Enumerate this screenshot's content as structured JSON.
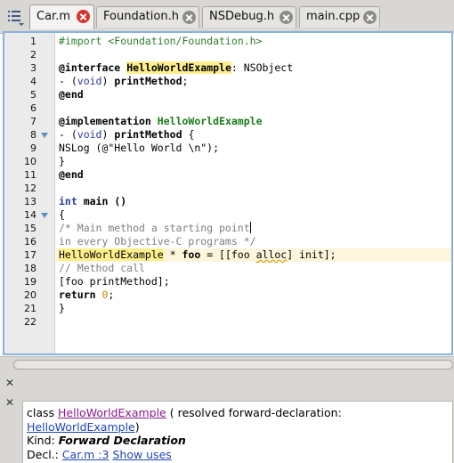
{
  "tabs": [
    {
      "label": "Car.m",
      "active": true
    },
    {
      "label": "Foundation.h",
      "active": false
    },
    {
      "label": "NSDebug.h",
      "active": false
    },
    {
      "label": "main.cpp",
      "active": false
    }
  ],
  "editor": {
    "line_numbers": [
      "1",
      "2",
      "3",
      "4",
      "5",
      "6",
      "7",
      "8",
      "9",
      "10",
      "11",
      "12",
      "13",
      "14",
      "15",
      "16",
      "17",
      "18",
      "19",
      "20",
      "21",
      "22"
    ],
    "fold_lines": [
      "8",
      "14"
    ],
    "highlighted_line": "17",
    "code": {
      "l1_pre": "#import <Foundation/Foundation.h>",
      "l3_kw": "@interface",
      "l3_cls": "HelloWorldExample",
      "l3_rest": ": NSObject",
      "l4_a": "- (",
      "l4_kw": "void",
      "l4_b": ") ",
      "l4_method": "printMethod",
      "l4_c": ";",
      "l5_kw": "@end",
      "l7_kw": "@implementation",
      "l7_cls": "HelloWorldExample",
      "l8_a": "- (",
      "l8_kw": "void",
      "l8_b": ") ",
      "l8_method": "printMethod",
      "l8_c": " {",
      "l9": "NSLog (@\"Hello World \\n\");",
      "l10": "}",
      "l11_kw": "@end",
      "l13_kw": "int",
      "l13_rest": " main ()",
      "l14": "{",
      "l15": "/* Main method a starting point",
      "l16": "in every Objective-C programs */",
      "l17_cls": "HelloWorldExample",
      "l17_a": " * ",
      "l17_var": "foo",
      "l17_b": " = [[foo ",
      "l17_alloc": "alloc",
      "l17_c": "] init];",
      "l18": "// Method call",
      "l19": "[foo printMethod];",
      "l20_kw": "return",
      "l20_a": " ",
      "l20_num": "0",
      "l20_b": ";",
      "l21": "}"
    }
  },
  "info_panel": {
    "class_prefix": "class ",
    "class_name": "HelloWorldExample",
    "resolved_text": " ( resolved forward-declaration: ",
    "resolved_link": "HelloWorldExample",
    "resolved_end": ")",
    "kind_label": "Kind: ",
    "kind_value": "Forward Declaration",
    "decl_label": "Decl.: ",
    "decl_link": "Car.m :3",
    "show_uses": "Show uses"
  },
  "icons": {
    "menu": "list-menu-icon",
    "tab_close": "close-icon",
    "fold": "fold-arrow-icon",
    "panel_close": "close-icon",
    "panel_expand": "expand-icon"
  },
  "colors": {
    "accent_border": "#88b3dc",
    "active_close": "#d3352c",
    "class_highlight": "#ffef8c",
    "current_line": "#fdf5dc",
    "link": "#2046b8"
  }
}
